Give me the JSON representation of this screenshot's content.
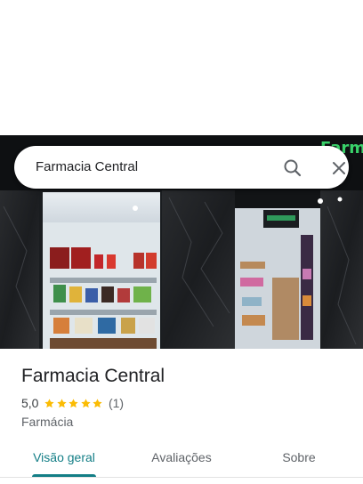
{
  "search": {
    "query": "Farmacia Central"
  },
  "place": {
    "name": "Farmacia Central",
    "rating": "5,0",
    "stars": 5,
    "review_count": "(1)",
    "category": "Farmácia",
    "sign_text": "Farmacia"
  },
  "tabs": [
    {
      "label": "Visão geral",
      "active": true
    },
    {
      "label": "Avaliações",
      "active": false
    },
    {
      "label": "Sobre",
      "active": false
    }
  ],
  "colors": {
    "accent": "#137e86",
    "star": "#fbbc04",
    "text": "#202124",
    "secondary": "#5f6368"
  },
  "icons": {
    "search": "search-icon",
    "close": "close-icon",
    "star": "star-icon"
  }
}
